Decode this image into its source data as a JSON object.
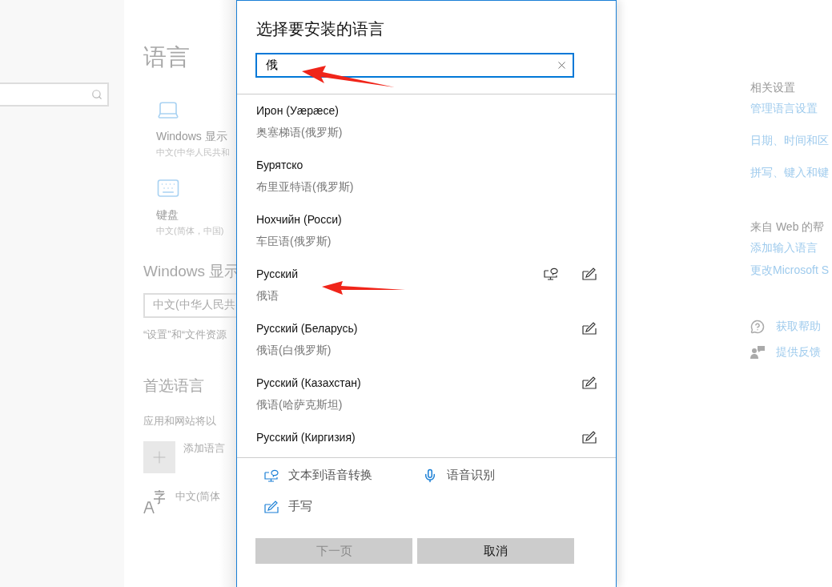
{
  "settings_page": {
    "title": "语言",
    "display": {
      "label": "Windows 显示",
      "value": "中文(中华人民共和"
    },
    "keyboard": {
      "label": "键盘",
      "value": "中文(简体，中国)"
    },
    "display_language": {
      "heading": "Windows 显示",
      "field_value": "中文(中华人民共",
      "note": "“设置”和“文件资源"
    },
    "preferred": {
      "heading": "首选语言",
      "description": "应用和网站将以",
      "add_label": "添加语言",
      "languages": [
        {
          "name": "中文(简体"
        }
      ]
    }
  },
  "related": {
    "heading": "相关设置",
    "links": [
      "管理语言设置",
      "日期、时间和区",
      "拼写、键入和键"
    ],
    "web_help": {
      "heading": "来自 Web 的帮",
      "links": [
        "添加输入语言",
        "更改Microsoft S"
      ]
    },
    "support": [
      {
        "kind": "help",
        "label": "获取帮助"
      },
      {
        "kind": "feedback",
        "label": "提供反馈"
      }
    ]
  },
  "dialog": {
    "title": "选择要安装的语言",
    "search": {
      "value": "俄"
    },
    "languages": [
      {
        "name": "Ирон (Уæрæсе)",
        "native": "奥塞梯语(俄罗斯)",
        "tts": false,
        "handwriting": false
      },
      {
        "name": "Бурятско",
        "native": "布里亚特语(俄罗斯)",
        "tts": false,
        "handwriting": false
      },
      {
        "name": "Нохчийн (Росси)",
        "native": "车臣语(俄罗斯)",
        "tts": false,
        "handwriting": false
      },
      {
        "name": "Русский",
        "native": "俄语",
        "tts": true,
        "handwriting": true
      },
      {
        "name": "Русский (Беларусь)",
        "native": "俄语(白俄罗斯)",
        "tts": false,
        "handwriting": true
      },
      {
        "name": "Русский (Казахстан)",
        "native": "俄语(哈萨克斯坦)",
        "tts": false,
        "handwriting": true
      },
      {
        "name": "Русский (Киргизия)",
        "tts": false,
        "handwriting": true
      }
    ],
    "legend": [
      {
        "kind": "tts",
        "label": "文本到语音转换"
      },
      {
        "kind": "speech",
        "label": "语音识别"
      },
      {
        "kind": "handwriting",
        "label": "手写"
      }
    ],
    "buttons": [
      {
        "label": "下一页",
        "disabled": true
      },
      {
        "label": "取消",
        "disabled": false
      }
    ]
  }
}
